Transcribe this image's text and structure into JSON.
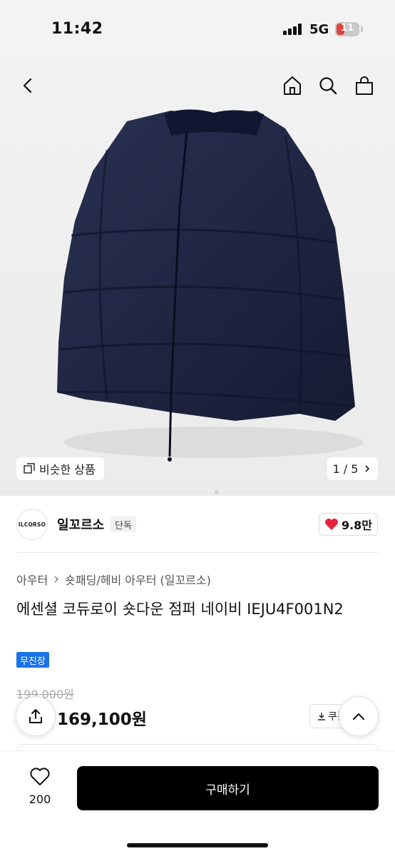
{
  "status_bar": {
    "time": "11:42",
    "network": "5G",
    "battery": "11"
  },
  "header": {
    "icons": [
      "back-icon",
      "home-icon",
      "search-icon",
      "shopping-bag-icon"
    ]
  },
  "gallery": {
    "similar_label": "비슷한 상품",
    "page_indicator": "1 / 5"
  },
  "brand": {
    "logo_text": "ILCORSO",
    "name": "일꼬르소",
    "badge": "단독",
    "likes": "9.8만"
  },
  "product": {
    "breadcrumb": [
      "아우터",
      "숏패딩/헤비 아우터 (일꼬르소)"
    ],
    "title": "에센셜 코듀로이 숏다운 점퍼 네이비 IEJU4F001N2",
    "tag": "무진장",
    "original_price": "199,000원",
    "sale_price": "169,100원",
    "coupon_label": "쿠폰"
  },
  "bottom_bar": {
    "wish_count": "200",
    "buy_label": "구매하기"
  },
  "colors": {
    "jacket": "#1d2440",
    "heart": "#e5243b",
    "tag": "#1a73e8",
    "buy_button": "#000000"
  }
}
